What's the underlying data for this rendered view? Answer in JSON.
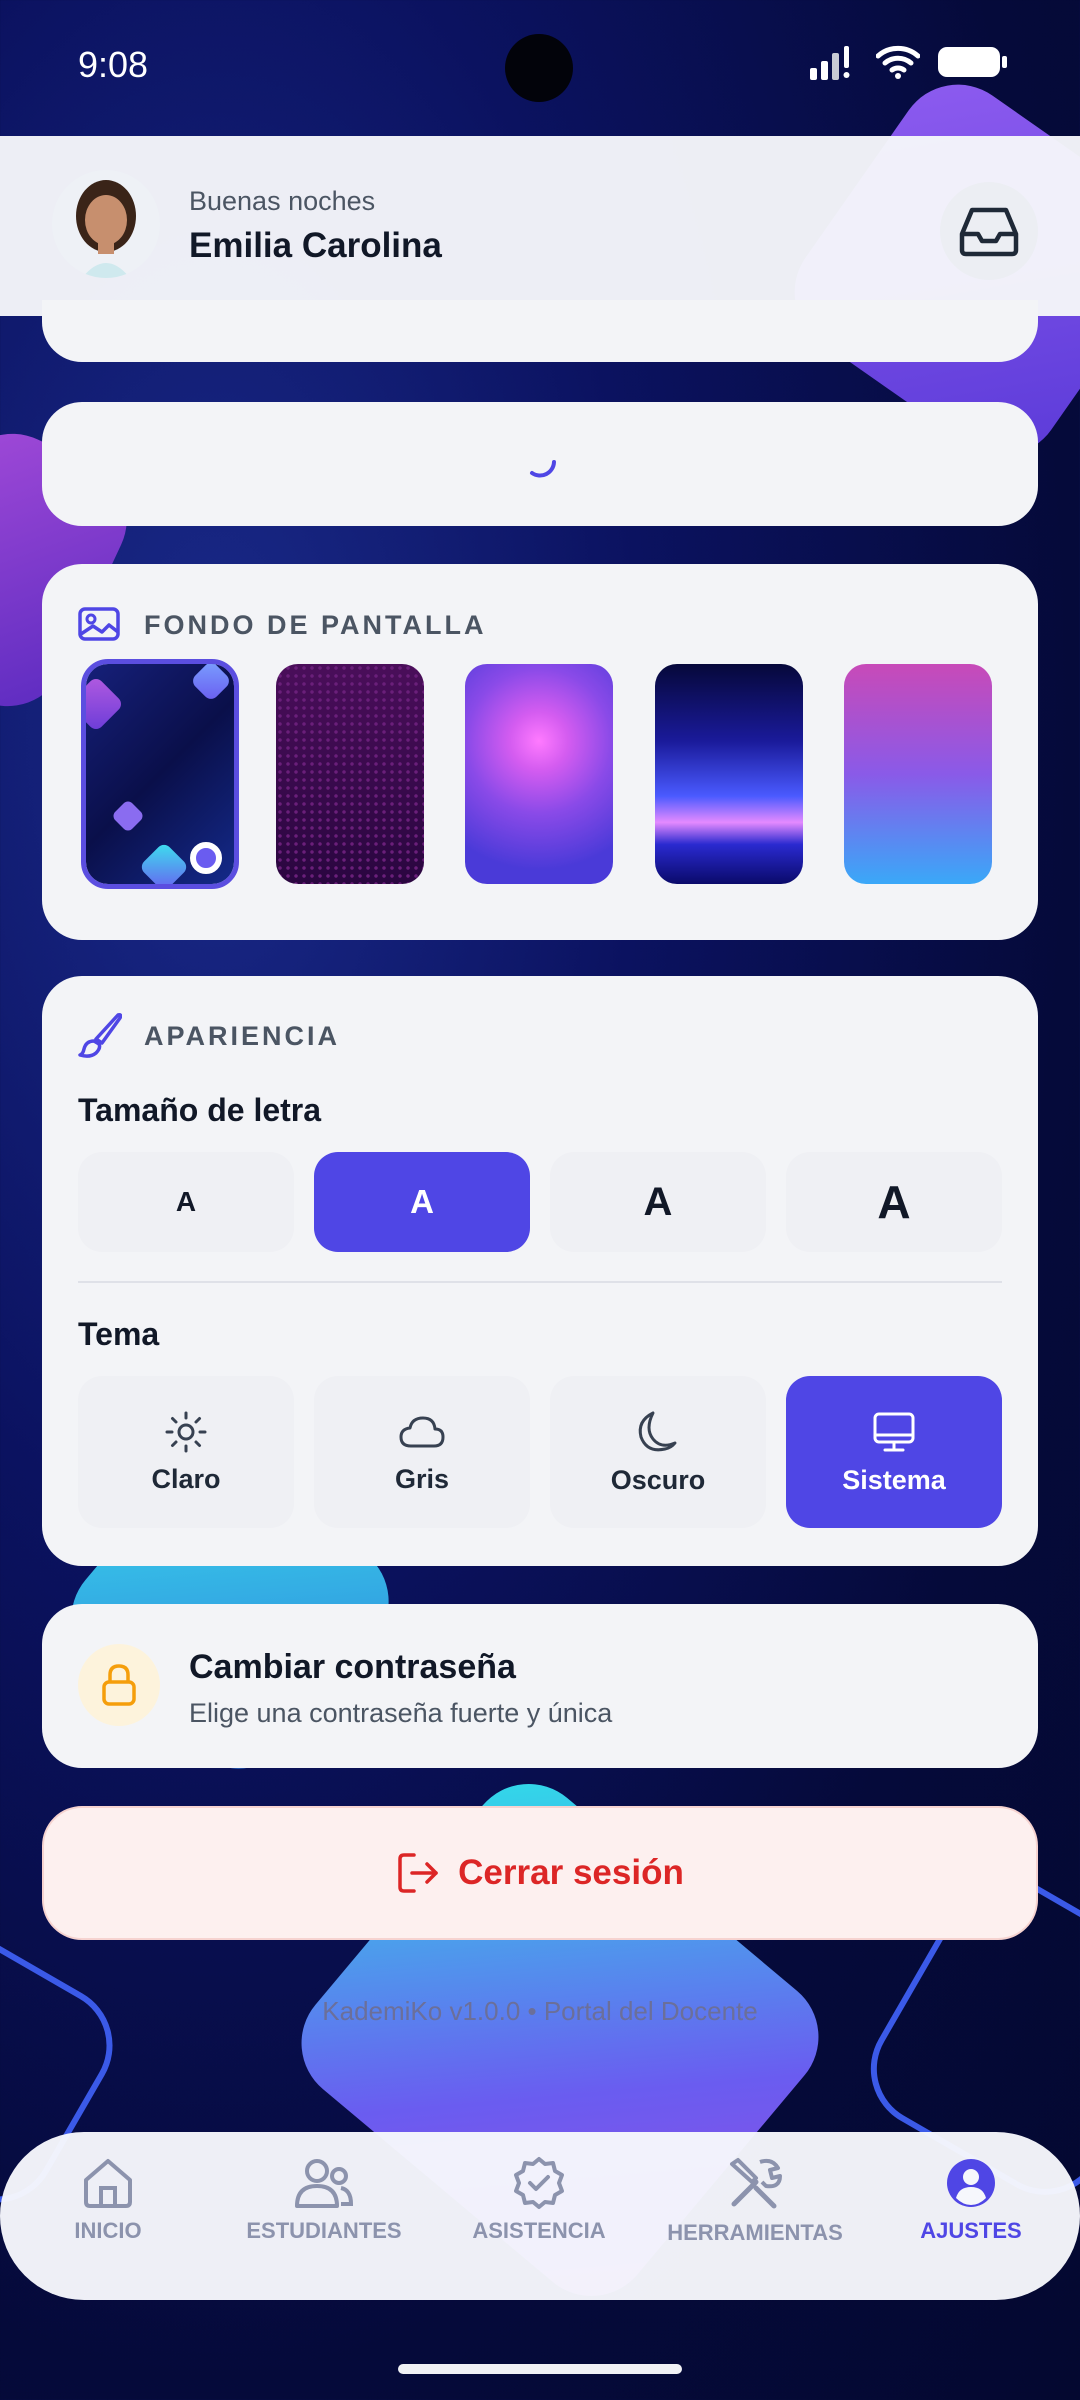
{
  "status_bar": {
    "time": "9:08"
  },
  "header": {
    "greeting": "Buenas noches",
    "name": "Emilia Carolina"
  },
  "wallpaper": {
    "title": "FONDO DE PANTALLA",
    "thumbnails": [
      {
        "name": "wallpaper-geometric-blue",
        "selected": true
      },
      {
        "name": "wallpaper-purple-dots",
        "selected": false
      },
      {
        "name": "wallpaper-circuit-violet",
        "selected": false
      },
      {
        "name": "wallpaper-blue-splash",
        "selected": false
      },
      {
        "name": "wallpaper-pink-triangles",
        "selected": false
      }
    ]
  },
  "appearance": {
    "title": "APARIENCIA",
    "font_size_label": "Tamaño de letra",
    "font_sizes": [
      "A",
      "A",
      "A",
      "A"
    ],
    "font_size_selected_index": 1,
    "theme_label": "Tema",
    "themes": [
      "Claro",
      "Gris",
      "Oscuro",
      "Sistema"
    ],
    "theme_selected_index": 3
  },
  "password": {
    "title": "Cambiar contraseña",
    "subtitle": "Elige una contraseña fuerte y única"
  },
  "logout": {
    "label": "Cerrar sesión"
  },
  "footer": {
    "version": "KademiKo v1.0.0 • Portal del Docente"
  },
  "nav": {
    "items": [
      "INICIO",
      "ESTUDIANTES",
      "ASISTENCIA",
      "HERRAMIENTAS",
      "AJUSTES"
    ],
    "active_index": 4
  },
  "colors": {
    "accent": "#4f46e5",
    "danger": "#dc2626",
    "lock_bg": "#fdf3dc",
    "lock_icon": "#f59e0b"
  }
}
